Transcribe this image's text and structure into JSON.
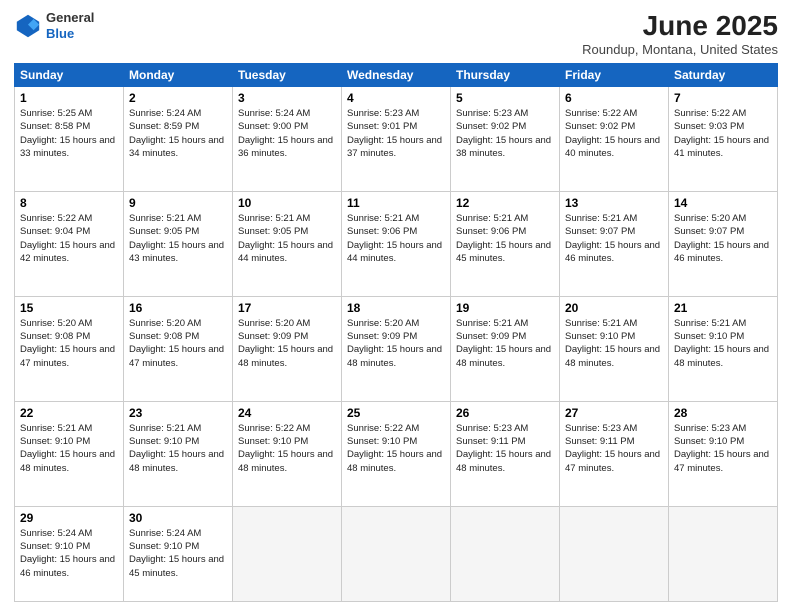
{
  "header": {
    "logo_general": "General",
    "logo_blue": "Blue",
    "main_title": "June 2025",
    "subtitle": "Roundup, Montana, United States"
  },
  "calendar": {
    "weekdays": [
      "Sunday",
      "Monday",
      "Tuesday",
      "Wednesday",
      "Thursday",
      "Friday",
      "Saturday"
    ],
    "weeks": [
      [
        {
          "day": "",
          "empty": true
        },
        {
          "day": "",
          "empty": true
        },
        {
          "day": "",
          "empty": true
        },
        {
          "day": "",
          "empty": true
        },
        {
          "day": "5",
          "sunrise": "5:23 AM",
          "sunset": "9:02 PM",
          "daylight": "15 hours and 38 minutes."
        },
        {
          "day": "6",
          "sunrise": "5:22 AM",
          "sunset": "9:02 PM",
          "daylight": "15 hours and 40 minutes."
        },
        {
          "day": "7",
          "sunrise": "5:22 AM",
          "sunset": "9:03 PM",
          "daylight": "15 hours and 41 minutes."
        }
      ],
      [
        {
          "day": "1",
          "sunrise": "5:25 AM",
          "sunset": "8:58 PM",
          "daylight": "15 hours and 33 minutes."
        },
        {
          "day": "2",
          "sunrise": "5:24 AM",
          "sunset": "8:59 PM",
          "daylight": "15 hours and 34 minutes."
        },
        {
          "day": "3",
          "sunrise": "5:24 AM",
          "sunset": "9:00 PM",
          "daylight": "15 hours and 36 minutes."
        },
        {
          "day": "4",
          "sunrise": "5:23 AM",
          "sunset": "9:01 PM",
          "daylight": "15 hours and 37 minutes."
        },
        {
          "day": "5",
          "sunrise": "5:23 AM",
          "sunset": "9:02 PM",
          "daylight": "15 hours and 38 minutes."
        },
        {
          "day": "6",
          "sunrise": "5:22 AM",
          "sunset": "9:02 PM",
          "daylight": "15 hours and 40 minutes."
        },
        {
          "day": "7",
          "sunrise": "5:22 AM",
          "sunset": "9:03 PM",
          "daylight": "15 hours and 41 minutes."
        }
      ],
      [
        {
          "day": "8",
          "sunrise": "5:22 AM",
          "sunset": "9:04 PM",
          "daylight": "15 hours and 42 minutes."
        },
        {
          "day": "9",
          "sunrise": "5:21 AM",
          "sunset": "9:05 PM",
          "daylight": "15 hours and 43 minutes."
        },
        {
          "day": "10",
          "sunrise": "5:21 AM",
          "sunset": "9:05 PM",
          "daylight": "15 hours and 44 minutes."
        },
        {
          "day": "11",
          "sunrise": "5:21 AM",
          "sunset": "9:06 PM",
          "daylight": "15 hours and 44 minutes."
        },
        {
          "day": "12",
          "sunrise": "5:21 AM",
          "sunset": "9:06 PM",
          "daylight": "15 hours and 45 minutes."
        },
        {
          "day": "13",
          "sunrise": "5:21 AM",
          "sunset": "9:07 PM",
          "daylight": "15 hours and 46 minutes."
        },
        {
          "day": "14",
          "sunrise": "5:20 AM",
          "sunset": "9:07 PM",
          "daylight": "15 hours and 46 minutes."
        }
      ],
      [
        {
          "day": "15",
          "sunrise": "5:20 AM",
          "sunset": "9:08 PM",
          "daylight": "15 hours and 47 minutes."
        },
        {
          "day": "16",
          "sunrise": "5:20 AM",
          "sunset": "9:08 PM",
          "daylight": "15 hours and 47 minutes."
        },
        {
          "day": "17",
          "sunrise": "5:20 AM",
          "sunset": "9:09 PM",
          "daylight": "15 hours and 48 minutes."
        },
        {
          "day": "18",
          "sunrise": "5:20 AM",
          "sunset": "9:09 PM",
          "daylight": "15 hours and 48 minutes."
        },
        {
          "day": "19",
          "sunrise": "5:21 AM",
          "sunset": "9:09 PM",
          "daylight": "15 hours and 48 minutes."
        },
        {
          "day": "20",
          "sunrise": "5:21 AM",
          "sunset": "9:10 PM",
          "daylight": "15 hours and 48 minutes."
        },
        {
          "day": "21",
          "sunrise": "5:21 AM",
          "sunset": "9:10 PM",
          "daylight": "15 hours and 48 minutes."
        }
      ],
      [
        {
          "day": "22",
          "sunrise": "5:21 AM",
          "sunset": "9:10 PM",
          "daylight": "15 hours and 48 minutes."
        },
        {
          "day": "23",
          "sunrise": "5:21 AM",
          "sunset": "9:10 PM",
          "daylight": "15 hours and 48 minutes."
        },
        {
          "day": "24",
          "sunrise": "5:22 AM",
          "sunset": "9:10 PM",
          "daylight": "15 hours and 48 minutes."
        },
        {
          "day": "25",
          "sunrise": "5:22 AM",
          "sunset": "9:10 PM",
          "daylight": "15 hours and 48 minutes."
        },
        {
          "day": "26",
          "sunrise": "5:23 AM",
          "sunset": "9:11 PM",
          "daylight": "15 hours and 48 minutes."
        },
        {
          "day": "27",
          "sunrise": "5:23 AM",
          "sunset": "9:11 PM",
          "daylight": "15 hours and 47 minutes."
        },
        {
          "day": "28",
          "sunrise": "5:23 AM",
          "sunset": "9:10 PM",
          "daylight": "15 hours and 47 minutes."
        }
      ],
      [
        {
          "day": "29",
          "sunrise": "5:24 AM",
          "sunset": "9:10 PM",
          "daylight": "15 hours and 46 minutes."
        },
        {
          "day": "30",
          "sunrise": "5:24 AM",
          "sunset": "9:10 PM",
          "daylight": "15 hours and 45 minutes."
        },
        {
          "day": "",
          "empty": true
        },
        {
          "day": "",
          "empty": true
        },
        {
          "day": "",
          "empty": true
        },
        {
          "day": "",
          "empty": true
        },
        {
          "day": "",
          "empty": true
        }
      ]
    ]
  }
}
